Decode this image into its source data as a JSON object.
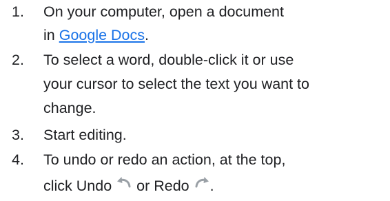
{
  "steps": [
    {
      "number": "1.",
      "line1": "On your computer, open a document",
      "line2_prefix": "in ",
      "link_text": "Google Docs",
      "line2_suffix": "."
    },
    {
      "number": "2.",
      "lines": [
        "To select a word, double-click it or use",
        "your cursor to select the text you want to",
        "change."
      ]
    },
    {
      "number": "3.",
      "line1": "Start editing."
    },
    {
      "number": "4.",
      "line1": "To undo or redo an action, at the top,",
      "line2_part1": "click Undo ",
      "undo_icon": "undo-icon",
      "line2_part2": " or Redo ",
      "redo_icon": "redo-icon",
      "line2_part3": "."
    }
  ],
  "colors": {
    "text": "#202124",
    "link": "#1a73e8",
    "icon": "#9aa0a6"
  }
}
